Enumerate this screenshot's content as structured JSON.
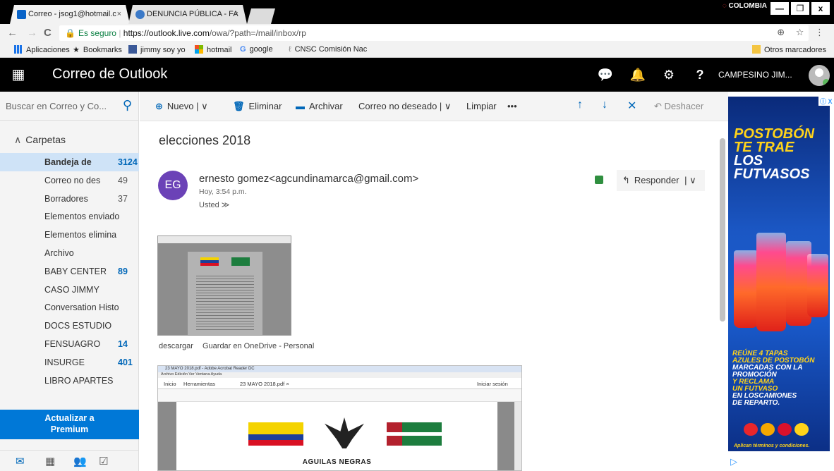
{
  "browser": {
    "tabs": [
      {
        "label": "Correo - jsog1@hotmail.c",
        "close": "×"
      },
      {
        "label": "DENUNCIA PÚBLICA - FA",
        "close": "×"
      }
    ],
    "region": "COLOMBIA",
    "window_controls": [
      "—",
      "❐",
      "x"
    ],
    "nav": {
      "back": "←",
      "forward": "→",
      "reload": "C"
    },
    "url_secure": "Es seguro",
    "url_host": "https://outlook.live.com",
    "url_path": "/owa/?path=/mail/inbox/rp",
    "url_actions": "⊕ ☆ ⋮",
    "bookmarks": [
      {
        "label": "Aplicaciones",
        "icon": "apps-icon",
        "color": "#1a73e8"
      },
      {
        "label": "Bookmarks",
        "icon": "star-icon",
        "color": "#333333"
      },
      {
        "label": "jimmy soy yo",
        "icon": "facebook-icon",
        "color": "#3b5998"
      },
      {
        "label": "hotmail",
        "icon": "microsoft-icon",
        "color": "#f25022"
      },
      {
        "label": "google",
        "icon": "google-icon",
        "color": "#4285f4"
      },
      {
        "label": "CNSC Comisión Nac",
        "icon": "cnsc-icon",
        "color": "#888888"
      }
    ],
    "other_bookmarks": "Otros marcadores"
  },
  "header": {
    "app_title": "Correo de Outlook",
    "icons": [
      "chat-icon",
      "bell-icon",
      "gear-icon",
      "help-icon"
    ],
    "icon_glyphs": [
      "▼",
      "🔔",
      "⚙",
      "?"
    ],
    "user_name": "CAMPESINO JIM...",
    "brand_color": "#000000"
  },
  "sidebar": {
    "search_placeholder": "Buscar en Correo y Co...",
    "folders_label": "Carpetas",
    "folders": [
      {
        "name": "Bandeja de",
        "count": "3124",
        "selected": true,
        "unread": true
      },
      {
        "name": "Correo no des",
        "count": "49",
        "unread": false
      },
      {
        "name": "Borradores",
        "count": "37",
        "unread": false
      },
      {
        "name": "Elementos enviado",
        "count": "",
        "unread": false
      },
      {
        "name": "Elementos elimina",
        "count": "",
        "unread": false
      },
      {
        "name": "Archivo",
        "count": "",
        "unread": false
      },
      {
        "name": "BABY CENTER",
        "count": "89",
        "unread": true
      },
      {
        "name": "CASO JIMMY",
        "count": "",
        "unread": false
      },
      {
        "name": "Conversation Histo",
        "count": "",
        "unread": false
      },
      {
        "name": "DOCS ESTUDIO",
        "count": "",
        "unread": false
      },
      {
        "name": "FENSUAGRO",
        "count": "14",
        "unread": true
      },
      {
        "name": "INSURGE",
        "count": "401",
        "unread": true
      },
      {
        "name": "LIBRO APARTES",
        "count": "",
        "unread": false
      }
    ],
    "upgrade_line1": "Actualizar a",
    "upgrade_line2": "Premium",
    "bottom_icons": [
      "mail-icon",
      "calendar-icon",
      "people-icon",
      "tasks-icon"
    ]
  },
  "toolbar": {
    "new": "Nuevo | ∨",
    "delete": "Eliminar",
    "archive": "Archivar",
    "junk": "Correo no deseado | ∨",
    "sweep": "Limpiar",
    "more": "•••",
    "undo": "Deshacer"
  },
  "message": {
    "subject": "elecciones 2018",
    "sender_initials": "EG",
    "sender": "ernesto gomez<agcundinamarca@gmail.com>",
    "time": "Hoy, 3:54 p.m.",
    "recipients": "Usted ≫",
    "reply_label": "Responder",
    "reply_dropdown": "| ∨",
    "attachment_download": "descargar",
    "attachment_onedrive": "Guardar en OneDrive - Personal",
    "pdf_window_title": "23 MAYO 2018.pdf - Adobe Acrobat Reader DC",
    "pdf_menu": "Archivo  Edición  Ver  Ventana  Ayuda",
    "pdf_tab_home": "Inicio",
    "pdf_tab_tools": "Herramientas",
    "pdf_tab_doc": "23 MAYO 2018.pdf  ×",
    "pdf_signin": "Iniciar sesión",
    "pdf_heading": "AGUILAS NEGRAS"
  },
  "ad": {
    "line1": "POSTOBÓN",
    "line2": "TE TRAE",
    "line3": "LOS",
    "line4": "FUTVASOS",
    "promo_lines": [
      "REÚNE 4 TAPAS",
      "AZULES DE POSTOBÓN",
      "MARCADAS CON LA",
      "PROMOCIÓN",
      "Y RECLAMA",
      "UN FUTVASO",
      "EN LOSCAMIONES",
      "DE REPARTO."
    ],
    "terms": "Aplican términos y condiciones."
  }
}
